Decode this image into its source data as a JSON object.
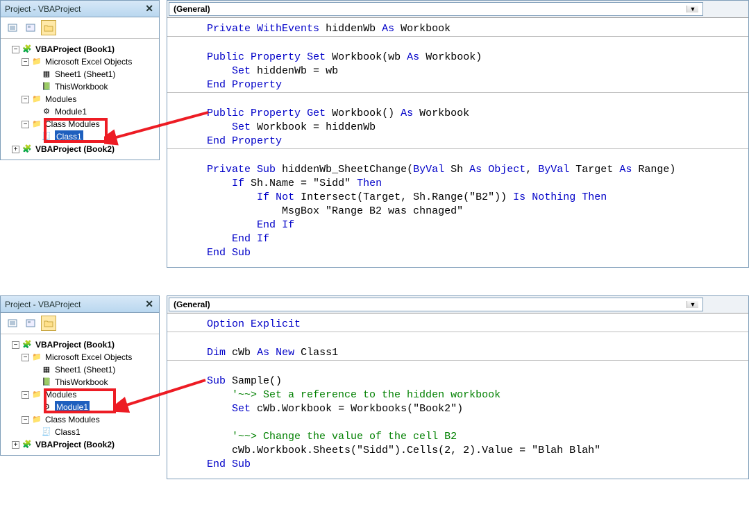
{
  "top": {
    "panelTitle": "Project - VBAProject",
    "combo": "(General)",
    "tree": {
      "root": "VBAProject (Book1)",
      "excelObjects": "Microsoft Excel Objects",
      "sheet1": "Sheet1 (Sheet1)",
      "thisWb": "ThisWorkbook",
      "modules": "Modules",
      "module1": "Module1",
      "classModules": "Class Modules",
      "class1": "Class1",
      "book2": "VBAProject (Book2)"
    },
    "code": {
      "l1a": "Private",
      "l1b": "WithEvents",
      "l1c": "hiddenWb",
      "l1d": "As",
      "l1e": "Workbook",
      "l2a": "Public",
      "l2b": "Property",
      "l2c": "Set",
      "l2d": "Workbook(wb",
      "l2e": "As",
      "l2f": "Workbook)",
      "l3a": "Set",
      "l3b": "hiddenWb = wb",
      "l4a": "End",
      "l4b": "Property",
      "l5a": "Public",
      "l5b": "Property",
      "l5c": "Get",
      "l5d": "Workbook()",
      "l5e": "As",
      "l5f": "Workbook",
      "l6a": "Set",
      "l6b": "Workbook = hiddenWb",
      "l7a": "End",
      "l7b": "Property",
      "l8a": "Private",
      "l8b": "Sub",
      "l8c": "hiddenWb_SheetChange(",
      "l8d": "ByVal",
      "l8e": "Sh",
      "l8f": "As",
      "l8g": "Object",
      "l8h": ",",
      "l8i": "ByVal",
      "l8j": "Target",
      "l8k": "As",
      "l8l": "Range)",
      "l9a": "If",
      "l9b": "Sh.Name = \"Sidd\"",
      "l9c": "Then",
      "l10a": "If",
      "l10b": "Not",
      "l10c": "Intersect(Target, Sh.Range(\"B2\"))",
      "l10d": "Is",
      "l10e": "Nothing",
      "l10f": "Then",
      "l11a": "MsgBox \"Range B2 was chnaged\"",
      "l12a": "End",
      "l12b": "If",
      "l13a": "End",
      "l13b": "If",
      "l14a": "End",
      "l14b": "Sub"
    }
  },
  "bottom": {
    "panelTitle": "Project - VBAProject",
    "combo": "(General)",
    "tree": {
      "root": "VBAProject (Book1)",
      "excelObjects": "Microsoft Excel Objects",
      "sheet1": "Sheet1 (Sheet1)",
      "thisWb": "ThisWorkbook",
      "modules": "Modules",
      "module1": "Module1",
      "classModules": "Class Modules",
      "class1": "Class1",
      "book2": "VBAProject (Book2)"
    },
    "code": {
      "l1a": "Option",
      "l1b": "Explicit",
      "l2a": "Dim",
      "l2b": "cWb",
      "l2c": "As",
      "l2d": "New",
      "l2e": "Class1",
      "l3a": "Sub",
      "l3b": "Sample()",
      "l4a": "'~~> Set a reference to the hidden workbook",
      "l5a": "Set",
      "l5b": "cWb.Workbook = Workbooks(\"Book2\")",
      "l6a": "'~~> Change the value of the cell B2",
      "l7a": "cWb.Workbook.Sheets(\"Sidd\").Cells(2, 2).Value = \"Blah Blah\"",
      "l8a": "End",
      "l8b": "Sub"
    }
  }
}
